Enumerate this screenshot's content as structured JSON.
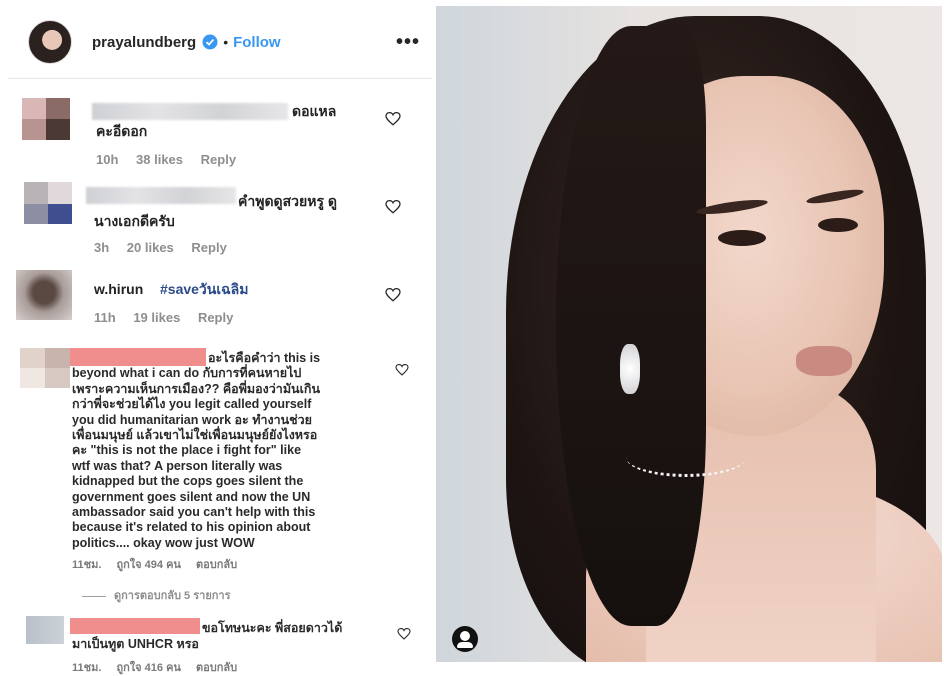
{
  "header": {
    "username": "prayalundberg",
    "separator": "•",
    "follow_label": "Follow",
    "more_label": "•••"
  },
  "comments": [
    {
      "text_line1": "ดอแหล",
      "text_line2": "คะอีดอก",
      "time": "10h",
      "likes": "38 likes",
      "reply": "Reply"
    },
    {
      "text_line1": "คำพูดดูสวยหรู ดู",
      "text_line2": "นางเอกดีครับ",
      "time": "3h",
      "likes": "20 likes",
      "reply": "Reply"
    },
    {
      "username": "w.hirun",
      "hashtag": "#saveวันเฉลิม",
      "time": "11h",
      "likes": "19 likes",
      "reply": "Reply"
    },
    {
      "lines": [
        "อะไรคือคำว่า this is",
        "beyond what i can do กับการที่คนหายไป",
        "เพราะความเห็นการเมือง?? คือพี่มองว่ามันเกิน",
        "กว่าพี่จะช่วยได้ไง you legit called yourself",
        "you did humanitarian work อะ ทำงานช่วย",
        "เพื่อนมนุษย์ แล้วเขาไม่ใช่เพื่อนมนุษย์ยังไงหรอ",
        "คะ \"this is not the place i fight for\" like",
        "wtf was that? A person literally was",
        "kidnapped but the cops goes silent the",
        "government goes silent and now the UN",
        "ambassador said you can't help with this",
        "because it's related to his opinion about",
        "politics.... okay wow just WOW"
      ],
      "time": "11ชม.",
      "likes": "ถูกใจ 494 คน",
      "reply": "ตอบกลับ",
      "view_replies": "ดูการตอบกลับ 5 รายการ"
    },
    {
      "lines": [
        "ขอโทษนะคะ พี่สอยดาวได้",
        "มาเป็นทูต UNHCR หรอ"
      ],
      "time": "11ชม.",
      "likes": "ถูกใจ 416 คน",
      "reply": "ตอบกลับ"
    }
  ],
  "colors": {
    "follow": "#3897f0",
    "verified": "#3897f0",
    "meta": "#8e8e8e",
    "redacted": "#f08d8d"
  }
}
